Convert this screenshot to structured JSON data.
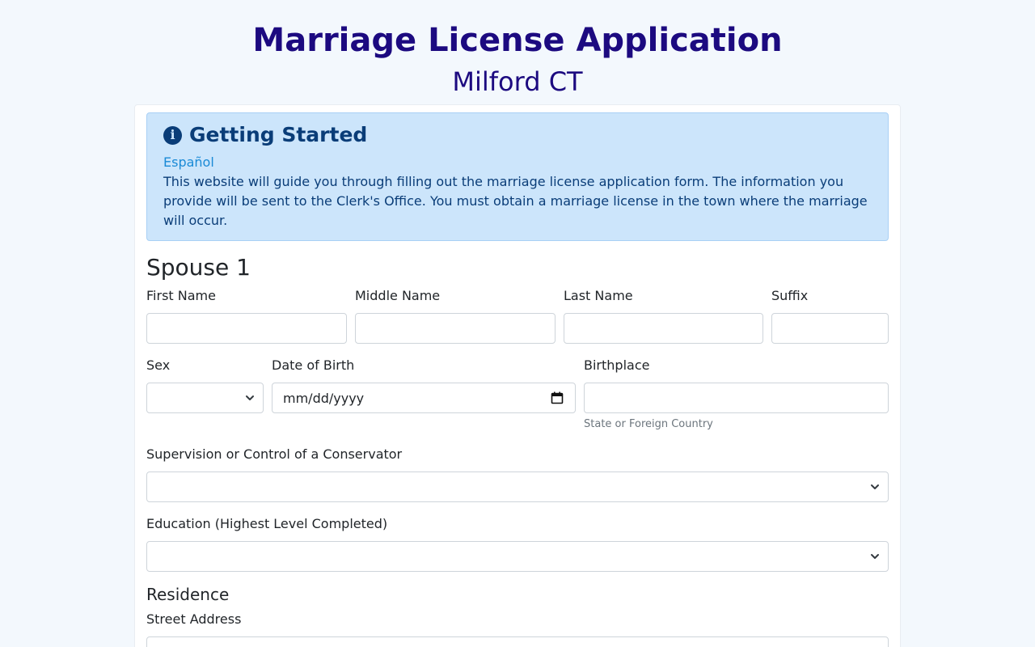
{
  "header": {
    "title": "Marriage License Application",
    "subtitle": "Milford CT"
  },
  "alert": {
    "icon": "info-circle-icon",
    "heading": "Getting Started",
    "link": "Español",
    "text": "This website will guide you through filling out the marriage license application form. The information you provide will be sent to the Clerk's Office. You must obtain a marriage license in the town where the marriage will occur."
  },
  "spouse1": {
    "title": "Spouse 1",
    "first_name": {
      "label": "First Name",
      "value": ""
    },
    "middle_name": {
      "label": "Middle Name",
      "value": ""
    },
    "last_name": {
      "label": "Last Name",
      "value": ""
    },
    "suffix": {
      "label": "Suffix",
      "value": ""
    },
    "sex": {
      "label": "Sex",
      "value": ""
    },
    "dob": {
      "label": "Date of Birth",
      "placeholder": "mm/dd/yyyy"
    },
    "birthplace": {
      "label": "Birthplace",
      "value": "",
      "help": "State or Foreign Country"
    },
    "conservator": {
      "label": "Supervision or Control of a Conservator",
      "value": ""
    },
    "education": {
      "label": "Education (Highest Level Completed)",
      "value": ""
    },
    "residence": {
      "title": "Residence",
      "street": {
        "label": "Street Address",
        "value": ""
      }
    }
  },
  "colors": {
    "page_bg": "#f3f8fd",
    "title": "#1c0a80",
    "alert_bg": "#cce5fb",
    "alert_text": "#0a3d78",
    "link": "#1a8ad6"
  }
}
